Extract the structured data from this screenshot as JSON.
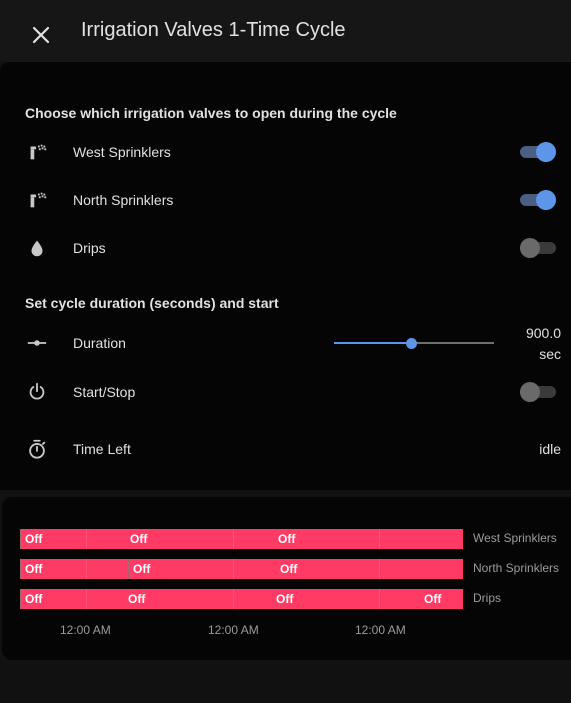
{
  "dialog": {
    "title": "Irrigation Valves 1-Time Cycle"
  },
  "valves_section": {
    "title": "Choose which irrigation valves to open during the cycle",
    "items": [
      {
        "label": "West Sprinklers",
        "icon": "sprinkler-icon",
        "state": "on"
      },
      {
        "label": "North Sprinklers",
        "icon": "sprinkler-icon",
        "state": "on"
      },
      {
        "label": "Drips",
        "icon": "water-drop-icon",
        "state": "off"
      }
    ]
  },
  "cycle_section": {
    "title": "Set cycle duration (seconds) and start",
    "duration": {
      "label": "Duration",
      "icon": "ray-vertex-icon",
      "value": "900.0",
      "unit": "sec",
      "level_fraction": 0.48
    },
    "start_stop": {
      "label": "Start/Stop",
      "icon": "power-icon",
      "state": "off"
    },
    "time_left": {
      "label": "Time Left",
      "icon": "timer-icon",
      "value": "idle"
    }
  },
  "history": {
    "rows": [
      {
        "entity": "West Sprinklers",
        "segments": [
          {
            "label": "Off",
            "start": 0.0,
            "end": 0.237
          },
          {
            "label": "Off",
            "start": 0.237,
            "end": 0.571
          },
          {
            "label": "Off",
            "start": 0.571,
            "end": 1.0
          }
        ]
      },
      {
        "entity": "North Sprinklers",
        "segments": [
          {
            "label": "Off",
            "start": 0.0,
            "end": 0.243
          },
          {
            "label": "Off",
            "start": 0.243,
            "end": 0.575
          },
          {
            "label": "Off",
            "start": 0.575,
            "end": 1.0
          }
        ]
      },
      {
        "entity": "Drips",
        "segments": [
          {
            "label": "Off",
            "start": 0.0,
            "end": 0.233
          },
          {
            "label": "Off",
            "start": 0.233,
            "end": 0.567
          },
          {
            "label": "Off",
            "start": 0.567,
            "end": 0.9
          },
          {
            "label": "Off",
            "start": 0.9,
            "end": 1.0
          }
        ]
      }
    ],
    "axis_ticks": [
      "12:00 AM",
      "12:00 AM",
      "12:00 AM"
    ],
    "bar_color": "#ff3b65"
  },
  "colors": {
    "accent": "#5c95e9",
    "background": "#111111",
    "card": "#050505"
  }
}
